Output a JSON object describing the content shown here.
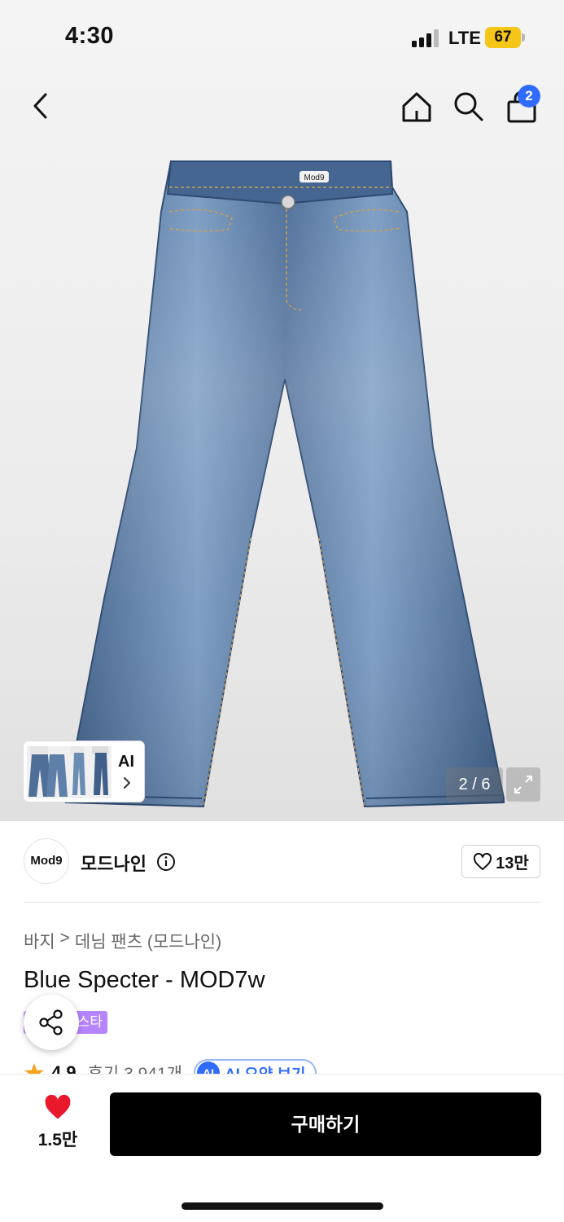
{
  "status": {
    "time": "4:30",
    "network": "LTE",
    "battery": "67"
  },
  "nav": {
    "cart_count": "2"
  },
  "gallery": {
    "ai_label": "AI",
    "pager": "2 / 6",
    "product_logo_text": "Mod9"
  },
  "brand": {
    "logo_text": "Mod9",
    "name": "모드나인",
    "likes": "13만"
  },
  "breadcrumb": {
    "category": "바지",
    "separator": ">",
    "subcategory": "데님 팬츠 (모드나인)"
  },
  "product": {
    "title": "Blue Specter - MOD7w",
    "tag": "스타",
    "rating": "4.9",
    "reviews": "후기 3,941개",
    "ai_summary_badge": "AI",
    "ai_summary": "AI 요약 보기"
  },
  "bottom_bar": {
    "wish_count": "1.5만",
    "buy_label": "구매하기"
  },
  "colors": {
    "accent_blue": "#2f6bff",
    "tag_purple": "#b784ff",
    "heart_red": "#e8192c",
    "battery_yellow": "#f5c518",
    "denim": "#5d7fa8"
  },
  "icons": [
    "chevron-left-icon",
    "home-icon",
    "search-icon",
    "shopping-bag-icon",
    "chevron-right-icon",
    "expand-icon",
    "info-icon",
    "heart-outline-icon",
    "share-icon",
    "star-icon",
    "heart-filled-icon"
  ]
}
